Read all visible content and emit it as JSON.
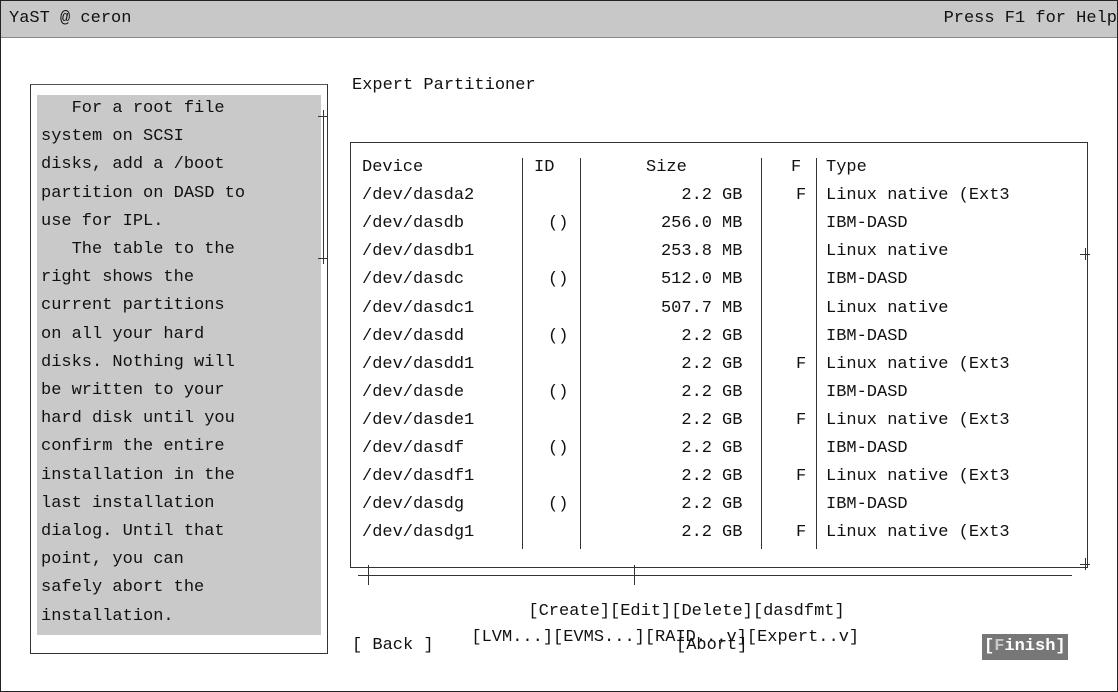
{
  "title_left": "YaST @ ceron",
  "title_right": "Press F1 for Help",
  "heading": "Expert Partitioner",
  "help_lines": [
    "   For a root file",
    "system on SCSI",
    "disks, add a /boot",
    "partition on DASD to",
    "use for IPL.",
    "   The table to the",
    "right shows the",
    "current partitions",
    "on all your hard",
    "disks. Nothing will",
    "be written to your",
    "hard disk until you",
    "confirm the entire",
    "installation in the",
    "last installation",
    "dialog. Until that",
    "point, you can",
    "safely abort the",
    "installation."
  ],
  "table": {
    "headers": [
      "Device",
      "ID",
      "Size",
      "F",
      "Type"
    ],
    "rows": [
      {
        "device": "/dev/dasda2",
        "id": "",
        "size": "2.2",
        "unit": "GB",
        "f": "F",
        "type": "Linux native (Ext3"
      },
      {
        "device": "/dev/dasdb",
        "id": "()",
        "size": "256.0",
        "unit": "MB",
        "f": "",
        "type": "IBM-DASD"
      },
      {
        "device": "/dev/dasdb1",
        "id": "",
        "size": "253.8",
        "unit": "MB",
        "f": "",
        "type": "Linux native"
      },
      {
        "device": "/dev/dasdc",
        "id": "()",
        "size": "512.0",
        "unit": "MB",
        "f": "",
        "type": "IBM-DASD"
      },
      {
        "device": "/dev/dasdc1",
        "id": "",
        "size": "507.7",
        "unit": "MB",
        "f": "",
        "type": "Linux native"
      },
      {
        "device": "/dev/dasdd",
        "id": "()",
        "size": "2.2",
        "unit": "GB",
        "f": "",
        "type": "IBM-DASD"
      },
      {
        "device": "/dev/dasdd1",
        "id": "",
        "size": "2.2",
        "unit": "GB",
        "f": "F",
        "type": "Linux native (Ext3"
      },
      {
        "device": "/dev/dasde",
        "id": "()",
        "size": "2.2",
        "unit": "GB",
        "f": "",
        "type": "IBM-DASD"
      },
      {
        "device": "/dev/dasde1",
        "id": "",
        "size": "2.2",
        "unit": "GB",
        "f": "F",
        "type": "Linux native (Ext3"
      },
      {
        "device": "/dev/dasdf",
        "id": "()",
        "size": "2.2",
        "unit": "GB",
        "f": "",
        "type": "IBM-DASD"
      },
      {
        "device": "/dev/dasdf1",
        "id": "",
        "size": "2.2",
        "unit": "GB",
        "f": "F",
        "type": "Linux native (Ext3"
      },
      {
        "device": "/dev/dasdg",
        "id": "()",
        "size": "2.2",
        "unit": "GB",
        "f": "",
        "type": "IBM-DASD"
      },
      {
        "device": "/dev/dasdg1",
        "id": "",
        "size": "2.2",
        "unit": "GB",
        "f": "F",
        "type": "Linux native (Ext3"
      }
    ]
  },
  "buttons": {
    "create": "[Create]",
    "edit": "[Edit]",
    "delete": "[Delete]",
    "dasdfmt": "[dasdfmt]",
    "lvm": "[LVM...]",
    "evms": "[EVMS...]",
    "raid": "[RAID...v]",
    "expert": "[Expert..v]",
    "back": "[ Back ]",
    "abort": "[Abort]",
    "finish_open": "[",
    "finish_hot": "F",
    "finish_rest": "inish]"
  }
}
